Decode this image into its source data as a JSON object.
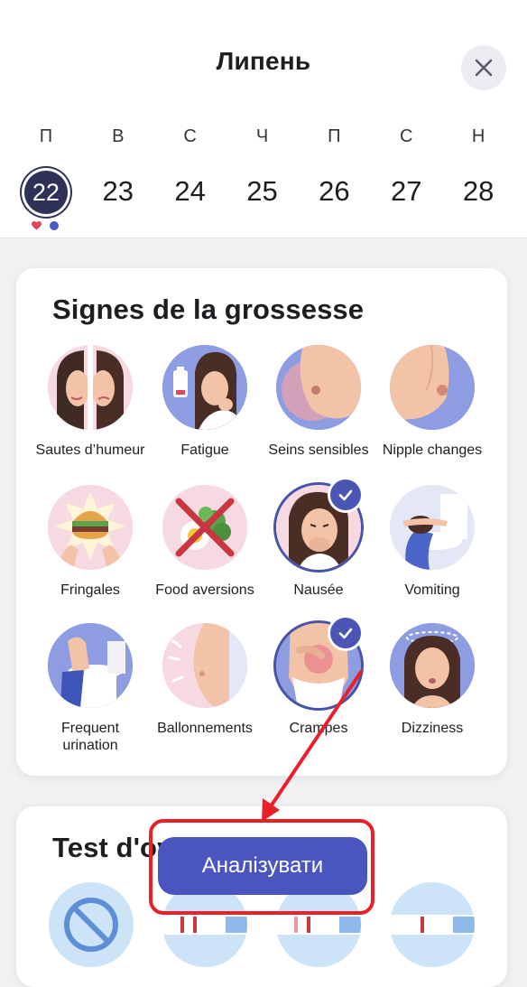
{
  "header": {
    "title": "Липень",
    "close_icon": "close-icon"
  },
  "week": {
    "days": [
      "П",
      "В",
      "С",
      "Ч",
      "П",
      "С",
      "Н"
    ],
    "dates": [
      "22",
      "23",
      "24",
      "25",
      "26",
      "27",
      "28"
    ],
    "selected": "22",
    "markers": [
      {
        "icon": "heart-dot",
        "color": "#e0455a"
      },
      {
        "icon": "blue-dot",
        "color": "#4a57c8"
      }
    ]
  },
  "symptoms": {
    "title": "Signes de la grossesse",
    "items": [
      {
        "label": "Sautes d’humeur",
        "icon": "mood-swings-icon",
        "checked": false
      },
      {
        "label": "Fatigue",
        "icon": "fatigue-icon",
        "checked": false
      },
      {
        "label": "Seins sensibles",
        "icon": "sensitive-breasts-icon",
        "checked": false
      },
      {
        "label": "Nipple changes",
        "icon": "nipple-changes-icon",
        "checked": false
      },
      {
        "label": "Fringales",
        "icon": "cravings-icon",
        "checked": false
      },
      {
        "label": "Food aversions",
        "icon": "food-aversions-icon",
        "checked": false
      },
      {
        "label": "Nausée",
        "icon": "nausea-icon",
        "checked": true
      },
      {
        "label": "Vomiting",
        "icon": "vomiting-icon",
        "checked": false
      },
      {
        "label": "Frequent urination",
        "icon": "urination-icon",
        "checked": false
      },
      {
        "label": "Ballonnements",
        "icon": "bloating-icon",
        "checked": false
      },
      {
        "label": "Crampes",
        "icon": "cramps-icon",
        "checked": true
      },
      {
        "label": "Dizziness",
        "icon": "dizziness-icon",
        "checked": false
      }
    ]
  },
  "test": {
    "title": "Test d'ovulation",
    "icons": [
      "no-test-icon",
      "test-strip-two-lines-icon",
      "test-strip-faint-line-icon",
      "test-strip-one-line-icon"
    ]
  },
  "action": {
    "label": "Аналізувати"
  },
  "colors": {
    "accent": "#4b55c0",
    "annotation": "#e8202a",
    "selected_date_bg": "#2e3158"
  }
}
